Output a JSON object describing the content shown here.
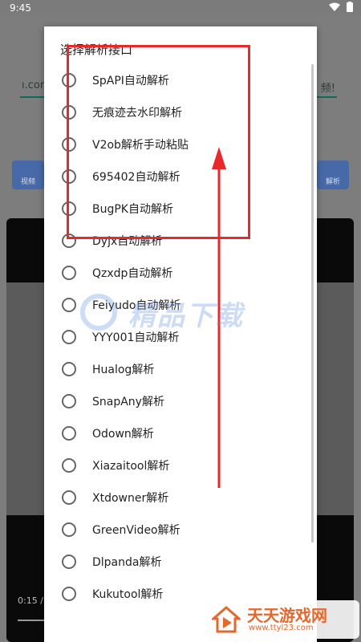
{
  "status_bar": {
    "time": "9:45"
  },
  "background": {
    "url_left": "ı.com",
    "url_right": "频!",
    "left_button": "视频",
    "right_button": "解析",
    "video_time": "0:15 /"
  },
  "dialog": {
    "title": "选择解析接口",
    "options": [
      {
        "label": "SpAPI自动解析",
        "selected": false
      },
      {
        "label": "无痕迹去水印解析",
        "selected": false
      },
      {
        "label": "V2ob解析手动粘贴",
        "selected": false
      },
      {
        "label": "695402自动解析",
        "selected": false
      },
      {
        "label": "BugPK自动解析",
        "selected": false
      },
      {
        "label": "Dyjx自动解析",
        "selected": false
      },
      {
        "label": "Qzxdp自动解析",
        "selected": false
      },
      {
        "label": "Feiyudo自动解析",
        "selected": false
      },
      {
        "label": "YYY001自动解析",
        "selected": false
      },
      {
        "label": "Hualog解析",
        "selected": false
      },
      {
        "label": "SnapAny解析",
        "selected": false
      },
      {
        "label": "Odown解析",
        "selected": false
      },
      {
        "label": "Xiazaitool解析",
        "selected": false
      },
      {
        "label": "Xtdowner解析",
        "selected": false
      },
      {
        "label": "GreenVideo解析",
        "selected": false
      },
      {
        "label": "Dlpanda解析",
        "selected": false
      },
      {
        "label": "Kukutool解析",
        "selected": false
      }
    ]
  },
  "annotations": {
    "color": "#e8282b"
  },
  "watermarks": {
    "center_text": "精品下载",
    "corner_name": "天天游戏网",
    "corner_url": "www.ttyl23.com"
  }
}
